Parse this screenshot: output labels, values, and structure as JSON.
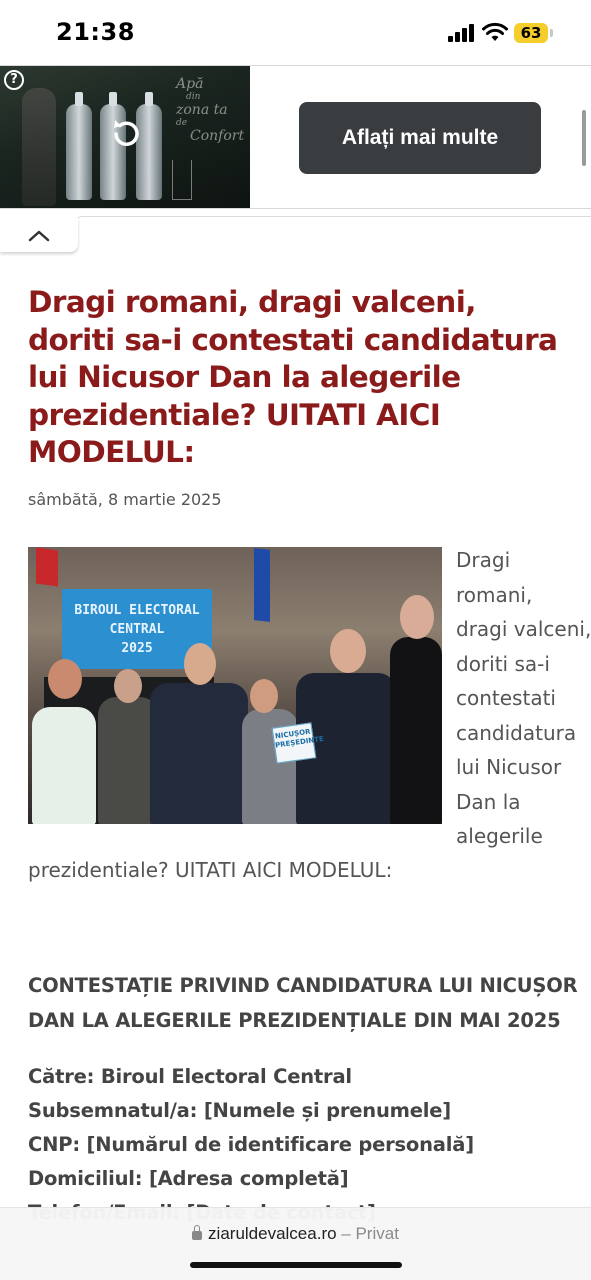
{
  "status_bar": {
    "time": "21:38",
    "battery": "63",
    "icons": [
      "signal-icon",
      "wifi-icon",
      "battery-icon"
    ]
  },
  "ad": {
    "help_symbol": "?",
    "slogan_lines": [
      "Apă",
      "din",
      "zona ta",
      "de",
      "Confort"
    ],
    "cta_label": "Aflați mai multe"
  },
  "article": {
    "title": "Dragi romani, dragi valceni, doriti sa-i contestati candidatura lui Nicusor Dan la alegerile prezidentiale? UITATI AICI MODELUL:",
    "date": "sâmbătă, 8 martie 2025",
    "photo": {
      "sign_lines": [
        "BIROUL ELECTORAL",
        "CENTRAL",
        "2025"
      ],
      "poster_text": "NICUȘOR PREȘEDINTE"
    },
    "lead_wrapped_lines": [
      "Dragi",
      "romani,",
      "dragi valceni,",
      "doriti sa-i",
      "contestati",
      "candidatura",
      "lui Nicusor",
      "Dan la",
      "alegerile"
    ],
    "lead_tail": "prezidentiale? UITATI AICI MODELUL:",
    "section_heading_lines": [
      "CONTESTAȚIE PRIVIND CANDIDATURA LUI NICUȘOR",
      "DAN LA ALEGERILE PREZIDENȚIALE DIN MAI 2025"
    ],
    "form_lines": [
      "Către: Biroul Electoral Central",
      "Subsemnatul/a: [Numele și prenumele]",
      "CNP: [Numărul de identificare personală]",
      "Domiciliul: [Adresa completă]",
      "Telefon/Email: [Date de contact]"
    ]
  },
  "browser": {
    "domain": "ziaruldevalcea.ro",
    "separator": " – ",
    "mode": "Privat"
  }
}
